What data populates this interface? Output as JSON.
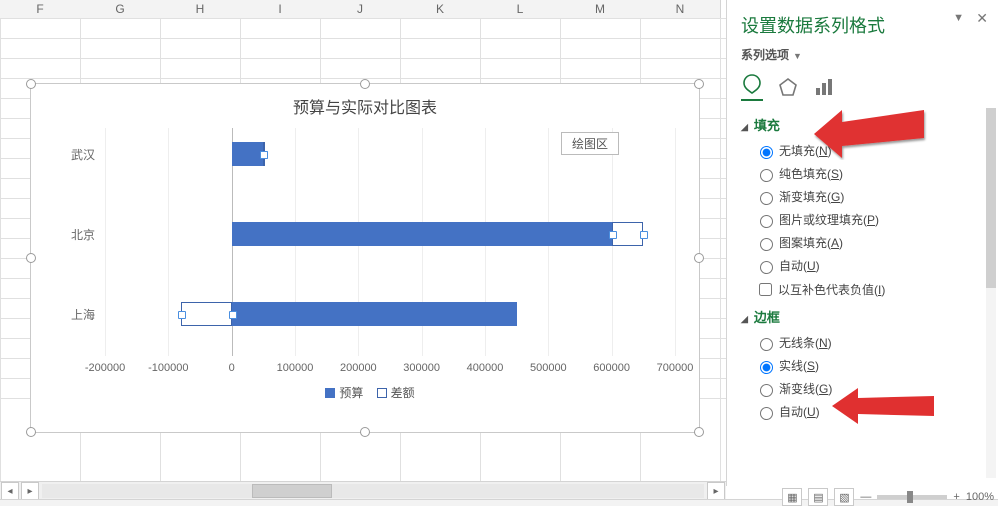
{
  "columns": [
    "F",
    "G",
    "H",
    "I",
    "J",
    "K",
    "L",
    "M",
    "N"
  ],
  "chart_data": {
    "type": "bar",
    "title": "预算与实际对比图表",
    "categories": [
      "武汉",
      "北京",
      "上海"
    ],
    "series": [
      {
        "name": "预算",
        "values": [
          50000,
          600000,
          450000
        ]
      },
      {
        "name": "差额",
        "values": [
          0,
          50000,
          -80000
        ]
      }
    ],
    "xlabel": "",
    "ylabel": "",
    "xlim": [
      -200000,
      700000
    ],
    "ticks": [
      -200000,
      -100000,
      0,
      100000,
      200000,
      300000,
      400000,
      500000,
      600000,
      700000
    ],
    "legend": [
      "预算",
      "差额"
    ],
    "tooltip": "绘图区"
  },
  "pane": {
    "title": "设置数据系列格式",
    "optionsLabel": "系列选项",
    "sections": {
      "fill": {
        "label": "填充",
        "items": [
          {
            "label": "无填充",
            "accel": "N",
            "checked": true
          },
          {
            "label": "纯色填充",
            "accel": "S",
            "checked": false
          },
          {
            "label": "渐变填充",
            "accel": "G",
            "checked": false
          },
          {
            "label": "图片或纹理填充",
            "accel": "P",
            "checked": false
          },
          {
            "label": "图案填充",
            "accel": "A",
            "checked": false
          },
          {
            "label": "自动",
            "accel": "U",
            "checked": false
          }
        ],
        "checkbox": {
          "label": "以互补色代表负值",
          "accel": "I"
        }
      },
      "border": {
        "label": "边框",
        "items": [
          {
            "label": "无线条",
            "accel": "N",
            "checked": false
          },
          {
            "label": "实线",
            "accel": "S",
            "checked": true
          },
          {
            "label": "渐变线",
            "accel": "G",
            "checked": false
          },
          {
            "label": "自动",
            "accel": "U",
            "checked": false
          }
        ]
      }
    }
  },
  "zoom": "100%"
}
